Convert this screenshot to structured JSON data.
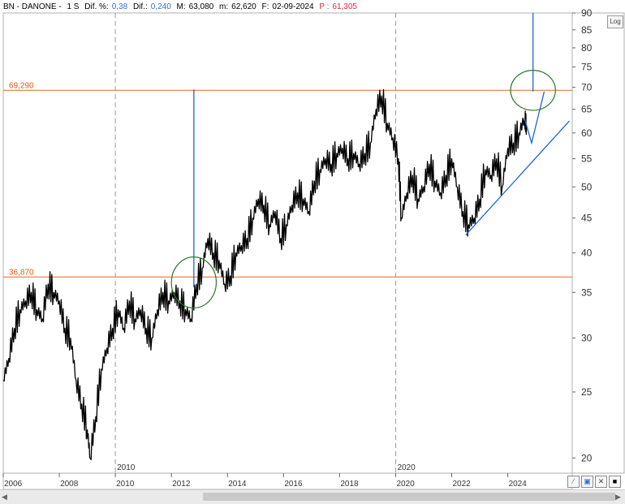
{
  "header": {
    "symbol": "BN - DANONE -",
    "period": "1 S",
    "dif_pct_label": "Dif. %:",
    "dif_pct_value": "0,38",
    "dif_label": "Dif.:",
    "dif_value": "0,240",
    "m_label": "M:",
    "m_value": "63,080",
    "m2_label": "m:",
    "m2_value": "62,620",
    "f_label": "F:",
    "f_value": "02-09-2024",
    "p_label": "P :",
    "p_value": "61,305"
  },
  "log_button": "Log",
  "icons": {
    "scroll_left": "arrow-left-icon",
    "scroll_right": "arrow-right-icon",
    "draw_tool": "line-tool-icon",
    "save": "save-icon",
    "close": "close-icon",
    "fill": "square-icon"
  },
  "chart_data": {
    "type": "line",
    "scale": "log",
    "ylim": [
      19,
      90
    ],
    "xlim": [
      2006,
      2026.3
    ],
    "y_ticks": [
      20,
      25,
      30,
      35,
      40,
      45,
      50,
      55,
      60,
      65,
      70,
      75,
      80,
      85,
      90
    ],
    "x_ticks": [
      "2006",
      "2008",
      "2010",
      "2012",
      "2014",
      "2016",
      "2018",
      "2020",
      "2022",
      "2024"
    ],
    "x_tick_values": [
      2006,
      2008,
      2010,
      2012,
      2014,
      2016,
      2018,
      2020,
      2022,
      2024
    ],
    "separator_labels": [
      {
        "label": "2010",
        "x": 2010
      },
      {
        "label": "2020",
        "x": 2020
      }
    ],
    "h_lines": [
      {
        "label": "69,290",
        "value": 69.29,
        "color": "#e8783a"
      },
      {
        "label": "36,870",
        "value": 36.87,
        "color": "#e8783a"
      }
    ],
    "series": [
      {
        "x": [
          2006.0,
          2006.2,
          2006.4,
          2006.6,
          2006.8,
          2007.0,
          2007.2,
          2007.4,
          2007.6,
          2007.8,
          2008.0,
          2008.2,
          2008.4,
          2008.6,
          2008.8,
          2009.0,
          2009.1,
          2009.3,
          2009.5,
          2009.7,
          2009.9,
          2010.1,
          2010.3,
          2010.5,
          2010.7,
          2010.9,
          2011.1,
          2011.3,
          2011.5,
          2011.7,
          2011.9,
          2012.1,
          2012.3,
          2012.5,
          2012.7,
          2012.9,
          2013.1,
          2013.3,
          2013.5,
          2013.7,
          2013.9,
          2014.1,
          2014.3,
          2014.5,
          2014.7,
          2014.9,
          2015.1,
          2015.3,
          2015.5,
          2015.7,
          2015.9,
          2016.1,
          2016.3,
          2016.5,
          2016.7,
          2016.9,
          2017.1,
          2017.3,
          2017.5,
          2017.7,
          2017.9,
          2018.1,
          2018.3,
          2018.5,
          2018.7,
          2018.9,
          2019.1,
          2019.3,
          2019.5,
          2019.7,
          2019.9,
          2020.1,
          2020.2,
          2020.4,
          2020.6,
          2020.8,
          2021.0,
          2021.2,
          2021.4,
          2021.6,
          2021.8,
          2022.0,
          2022.2,
          2022.4,
          2022.6,
          2022.8,
          2023.0,
          2023.2,
          2023.4,
          2023.6,
          2023.8,
          2024.0,
          2024.2,
          2024.4,
          2024.6,
          2024.67
        ],
        "y": [
          26,
          28,
          31,
          33,
          34,
          35,
          33,
          32,
          36,
          35,
          34,
          31,
          30,
          26,
          24,
          22,
          20,
          23,
          27,
          29,
          31,
          33,
          31,
          34,
          32,
          33,
          31,
          30,
          33,
          35,
          34,
          35,
          34,
          33,
          32,
          36,
          38,
          42,
          40,
          39,
          36,
          37,
          40,
          41,
          42,
          45,
          48,
          47,
          44,
          46,
          42,
          44,
          47,
          49,
          48,
          46,
          51,
          53,
          55,
          54,
          56,
          57,
          55,
          56,
          54,
          56,
          58,
          65,
          68,
          62,
          59,
          55,
          45,
          49,
          52,
          48,
          50,
          54,
          51,
          49,
          52,
          55,
          50,
          46,
          44,
          45,
          48,
          53,
          52,
          55,
          50,
          57,
          58,
          60,
          63,
          61.3
        ]
      }
    ],
    "annotations": [
      {
        "type": "trend_line",
        "from": [
          2022.5,
          42.5
        ],
        "to": [
          2026.2,
          62.5
        ],
        "color": "#1f66d8"
      },
      {
        "type": "projection_arrow",
        "from": [
          2012.8,
          35.6
        ],
        "to": [
          2012.8,
          69.5
        ],
        "color": "#1f66d8"
      },
      {
        "type": "projection_arrow",
        "from": [
          2024.9,
          69.0
        ],
        "to": [
          2024.9,
          92
        ],
        "color": "#1f66d8"
      },
      {
        "type": "projection_path",
        "points": [
          [
            2024.6,
            63
          ],
          [
            2024.85,
            58
          ],
          [
            2025.3,
            69
          ]
        ],
        "color": "#1f66d8"
      },
      {
        "type": "ellipse",
        "center": [
          2012.8,
          36.2
        ],
        "rx_years": 0.8,
        "ry_value_ratio": 1.09,
        "color": "#2a7a2a"
      },
      {
        "type": "ellipse",
        "center": [
          2024.9,
          69.3
        ],
        "rx_years": 0.8,
        "ry_value_ratio": 1.07,
        "color": "#2a7a2a"
      }
    ]
  }
}
